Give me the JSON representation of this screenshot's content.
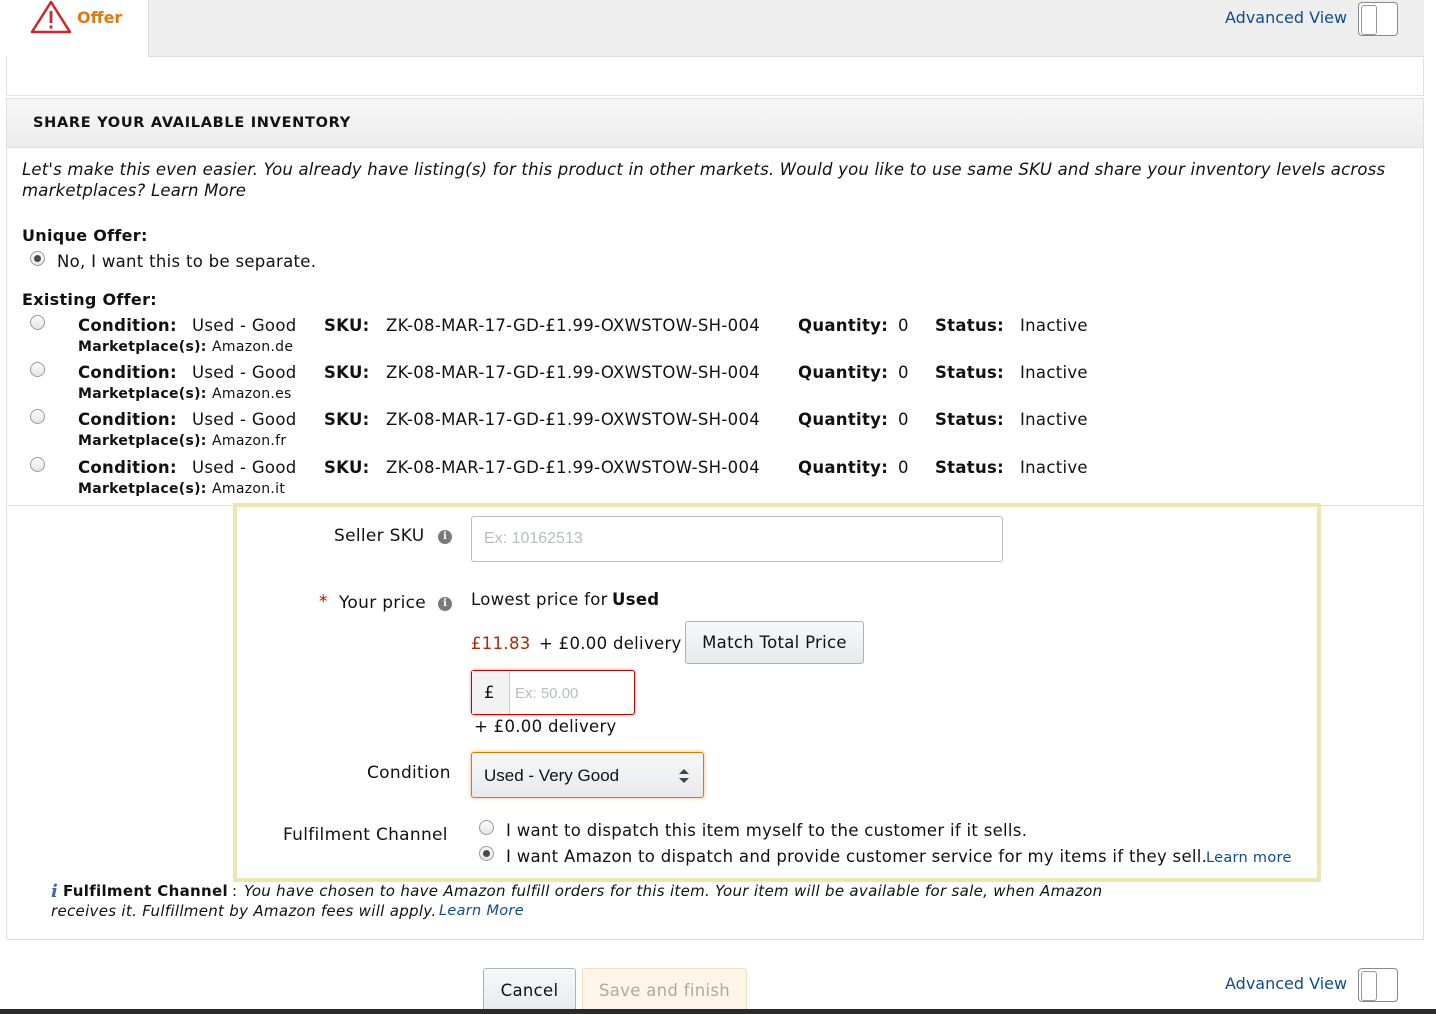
{
  "tabs": {
    "offer_label": "Offer"
  },
  "header": {
    "advanced_view_label": "Advanced View"
  },
  "share_inventory": {
    "title": "SHARE YOUR AVAILABLE INVENTORY",
    "intro_text": "Let's make this even easier. You already have listing(s) for this product in other markets. Would you like to use same SKU and share your inventory levels across marketplaces?",
    "intro_link": "Learn More",
    "unique_offer_label": "Unique Offer:",
    "unique_offer_option": "No, I want this to be separate.",
    "existing_offer_label": "Existing Offer:",
    "field_labels": {
      "condition": "Condition:",
      "sku": "SKU:",
      "quantity": "Quantity:",
      "status": "Status:",
      "marketplaces": "Marketplace(s):"
    },
    "offers": [
      {
        "condition": "Used - Good",
        "sku": "ZK-08-MAR-17-GD-£1.99-OXWSTOW-SH-004",
        "quantity": "0",
        "status": "Inactive",
        "marketplace": "Amazon.de"
      },
      {
        "condition": "Used - Good",
        "sku": "ZK-08-MAR-17-GD-£1.99-OXWSTOW-SH-004",
        "quantity": "0",
        "status": "Inactive",
        "marketplace": "Amazon.es"
      },
      {
        "condition": "Used - Good",
        "sku": "ZK-08-MAR-17-GD-£1.99-OXWSTOW-SH-004",
        "quantity": "0",
        "status": "Inactive",
        "marketplace": "Amazon.fr"
      },
      {
        "condition": "Used - Good",
        "sku": "ZK-08-MAR-17-GD-£1.99-OXWSTOW-SH-004",
        "quantity": "0",
        "status": "Inactive",
        "marketplace": "Amazon.it"
      }
    ]
  },
  "form": {
    "seller_sku_label": "Seller SKU",
    "seller_sku_placeholder": "Ex: 10162513",
    "required_marker": "*",
    "your_price_label": "Your price",
    "lowest_price_prefix": "Lowest price for",
    "lowest_price_condition": "Used",
    "lowest_price_value": "£11.83",
    "lowest_price_delivery": "+ £0.00 delivery",
    "match_button": "Match Total Price",
    "currency_symbol": "£",
    "price_placeholder": "Ex: 50.00",
    "price_delivery": "+ £0.00 delivery",
    "condition_label": "Condition",
    "condition_selected": "Used - Very Good",
    "fulfilment_label": "Fulfilment Channel",
    "fulfilment_option_merchant": "I want to dispatch this item myself to the customer if it sells.",
    "fulfilment_option_amazon": "I want Amazon to dispatch and provide customer service for my items if they sell.",
    "fulfilment_learn_more": "Learn more",
    "note_title": "Fulfilment Channel",
    "note_separator": ":",
    "note_text_line1": "You have chosen to have Amazon fulfill orders for this item. Your item will be available for sale, when Amazon",
    "note_text_line2": "receives it. Fulfillment by Amazon fees will apply.",
    "note_learn_more": "Learn More"
  },
  "footer": {
    "cancel_label": "Cancel",
    "save_label": "Save and finish",
    "advanced_view_label": "Advanced View"
  },
  "colors": {
    "offer_tab": "#e07a10",
    "link": "#0f4b91",
    "price_red": "#b12704",
    "highlight_border": "#efe5b3",
    "select_focus": "#e77600"
  }
}
